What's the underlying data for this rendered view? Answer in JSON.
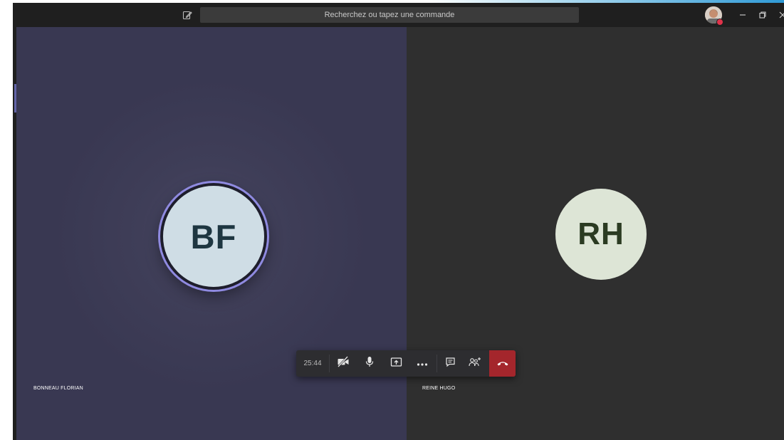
{
  "topbar": {
    "search_placeholder": "Recherchez ou tapez une commande"
  },
  "icons": {
    "compose": "compose-icon",
    "minimize": "minimize-icon",
    "restore": "restore-icon",
    "close": "close-icon"
  },
  "participants": [
    {
      "initials": "BF",
      "name": "BONNEAU FLORIAN",
      "avatar_color": "#cfdde5",
      "speaking": true
    },
    {
      "initials": "RH",
      "name": "REINE HUGO",
      "avatar_color": "#dde5d6",
      "speaking": false
    }
  ],
  "call_controls": {
    "timer": "25:44",
    "buttons": [
      {
        "name": "camera-off",
        "icon": "camera-off-icon"
      },
      {
        "name": "microphone",
        "icon": "microphone-icon"
      },
      {
        "name": "share-screen",
        "icon": "share-screen-icon"
      },
      {
        "name": "more-actions",
        "icon": "more-icon"
      },
      {
        "name": "chat",
        "icon": "chat-icon"
      },
      {
        "name": "participants",
        "icon": "participants-icon"
      },
      {
        "name": "hang-up",
        "icon": "hang-up-icon"
      }
    ]
  },
  "colors": {
    "accent": "#6264a7",
    "speaking_ring": "#8f8ae0",
    "hangup": "#a4262c",
    "topbar": "#1f1f1f"
  }
}
